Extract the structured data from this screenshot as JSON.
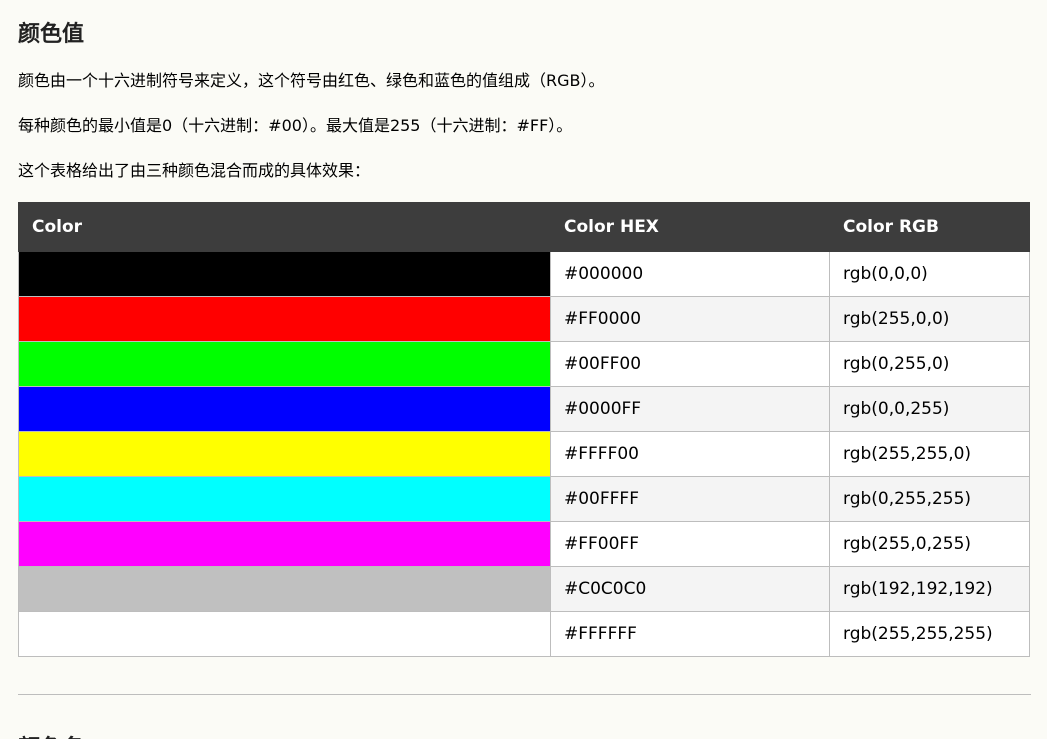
{
  "page": {
    "title": "颜色值",
    "paragraphs": [
      "颜色由一个十六进制符号来定义，这个符号由红色、绿色和蓝色的值组成（RGB）。",
      "每种颜色的最小值是0（十六进制：#00）。最大值是255（十六进制：#FF）。",
      "这个表格给出了由三种颜色混合而成的具体效果："
    ],
    "next_heading": "..."
  },
  "table": {
    "headers": [
      "Color",
      "Color HEX",
      "Color RGB"
    ],
    "rows": [
      {
        "swatch": "#000000",
        "hex": "#000000",
        "rgb": "rgb(0,0,0)"
      },
      {
        "swatch": "#FF0000",
        "hex": "#FF0000",
        "rgb": "rgb(255,0,0)"
      },
      {
        "swatch": "#00FF00",
        "hex": "#00FF00",
        "rgb": "rgb(0,255,0)"
      },
      {
        "swatch": "#0000FF",
        "hex": "#0000FF",
        "rgb": "rgb(0,0,255)"
      },
      {
        "swatch": "#FFFF00",
        "hex": "#FFFF00",
        "rgb": "rgb(255,255,0)"
      },
      {
        "swatch": "#00FFFF",
        "hex": "#00FFFF",
        "rgb": "rgb(0,255,255)"
      },
      {
        "swatch": "#FF00FF",
        "hex": "#FF00FF",
        "rgb": "rgb(255,0,255)"
      },
      {
        "swatch": "#C0C0C0",
        "hex": "#C0C0C0",
        "rgb": "rgb(192,192,192)"
      },
      {
        "swatch": "#FFFFFF",
        "hex": "#FFFFFF",
        "rgb": "rgb(255,255,255)"
      }
    ]
  },
  "colors": {
    "header_bg": "#3d3d3d",
    "page_bg": "#fbfbf6",
    "alt_row_bg": "#f4f4f4"
  }
}
